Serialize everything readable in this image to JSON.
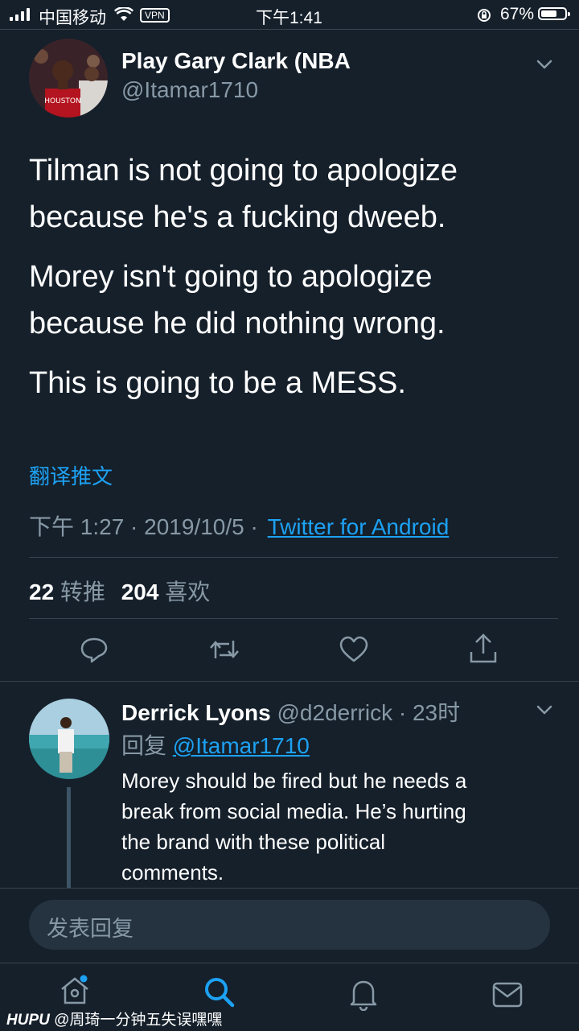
{
  "status_bar": {
    "carrier": "中国移动",
    "vpn": "VPN",
    "time": "下午1:41",
    "battery": "67%",
    "battery_level": 0.67
  },
  "tweet": {
    "author_name": "Play Gary Clark (NBA",
    "author_handle": "@Itamar1710",
    "text_lines": [
      "Tilman is not going to apologize",
      "because he's a fucking dweeb.",
      "Morey isn't going to apologize",
      "because he did nothing wrong.",
      "This is going to be a MESS."
    ],
    "translate_label": "翻译推文",
    "timestamp": "下午 1:27 · 2019/10/5 ·",
    "source": "Twitter for Android",
    "retweet_count": "22",
    "retweet_label": "转推",
    "like_count": "204",
    "like_label": "喜欢",
    "avatar_jersey": "HOUSTON"
  },
  "actions": [
    "reply-icon",
    "retweet-icon",
    "like-icon",
    "share-icon"
  ],
  "reply": {
    "author_name": "Derrick Lyons",
    "author_handle": "@d2derrick · 23时",
    "reply_prefix": "回复",
    "reply_to": "@Itamar1710",
    "text_lines": [
      "Morey should be fired but he needs a",
      "break from social media. He’s hurting",
      "the brand with these political",
      "comments."
    ]
  },
  "composer": {
    "placeholder": "发表回复"
  },
  "bottom_nav": [
    "home-icon",
    "search-icon",
    "notifications-icon",
    "messages-icon"
  ],
  "watermark": {
    "brand": "HUPU",
    "text": "@周琦一分钟五失误嘿嘿"
  },
  "colors": {
    "background": "#15202b",
    "accent": "#1da1f2",
    "secondary_text": "#8899a6",
    "divider": "#38444d"
  }
}
